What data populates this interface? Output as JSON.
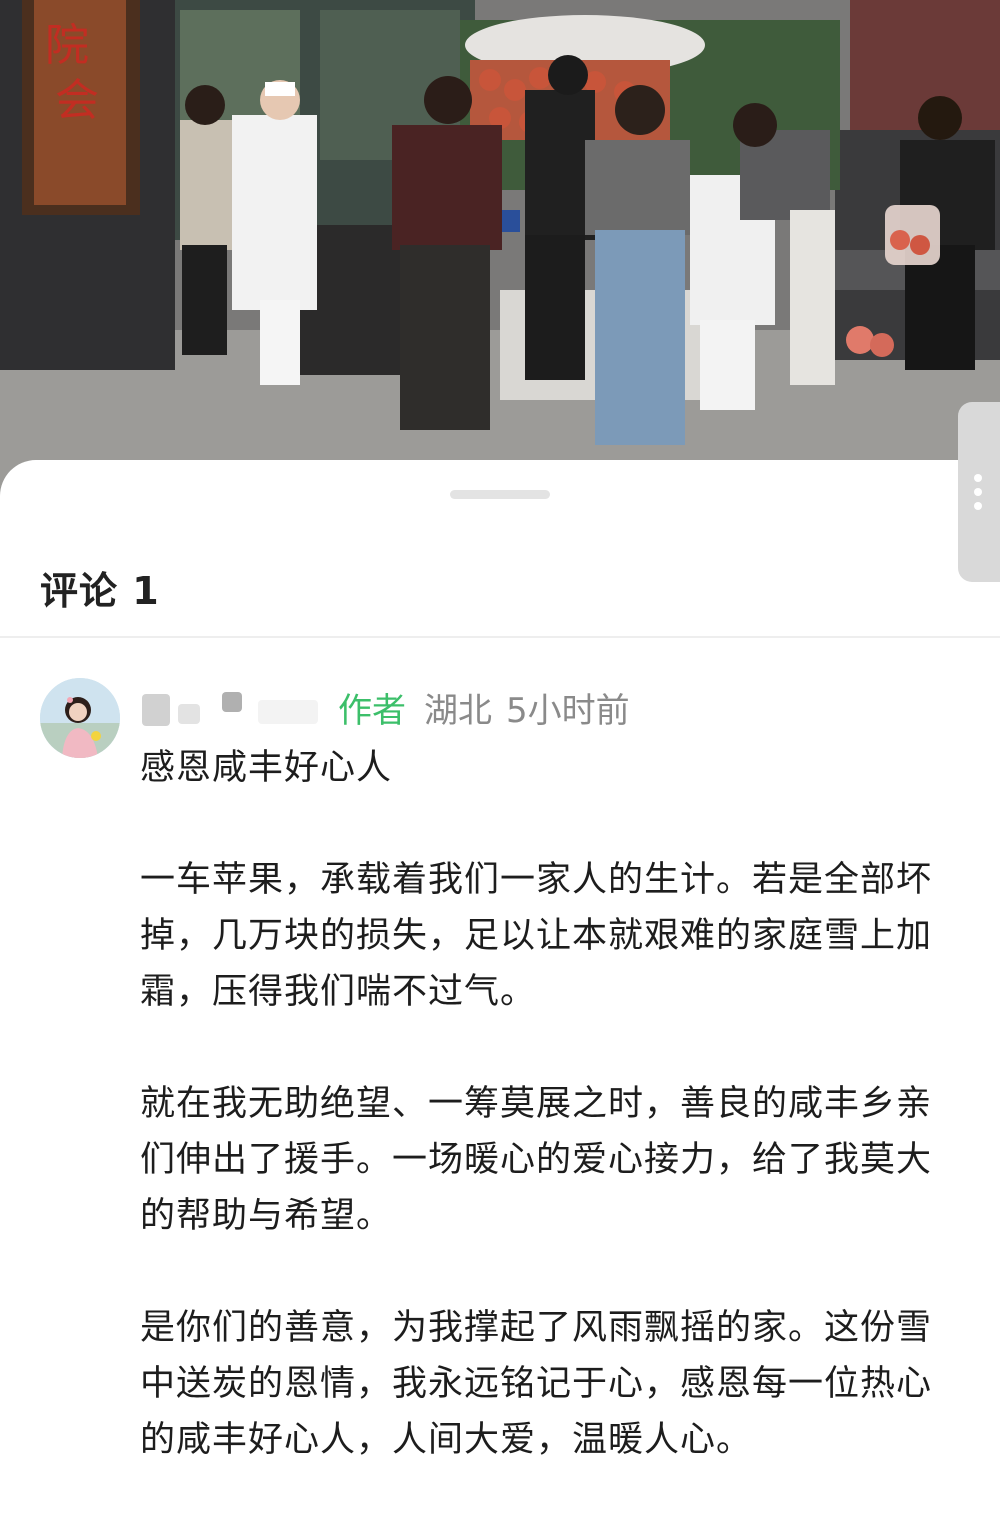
{
  "post": {
    "photo_description": ""
  },
  "comments": {
    "title": "评论 1"
  },
  "comment": {
    "author_tag": "作者",
    "location": "湖北",
    "time": "5小时前",
    "paragraphs": [
      "感恩咸丰好心人",
      "一车苹果，承载着我们一家人的生计。若是全部坏掉，几万块的损失，足以让本就艰难的家庭雪上加霜，压得我们喘不过气。",
      "就在我无助绝望、一筹莫展之时，善良的咸丰乡亲们伸出了援手。一场暖心的爱心接力，给了我莫大的帮助与希望。",
      "是你们的善意，为我撑起了风雨飘摇的家。这份雪中送炭的恩情，我永远铭记于心，感恩每一位热心的咸丰好心人，人间大爱，温暖人心。"
    ]
  },
  "colors": {
    "author_tag": "#3cbf6a",
    "meta_gray": "#8a8a8a",
    "text": "#1d1d1d"
  }
}
